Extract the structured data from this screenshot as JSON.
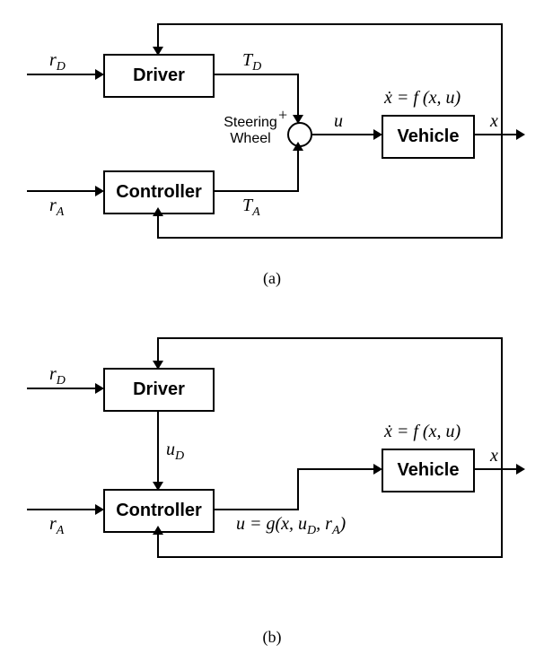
{
  "diagram_a": {
    "blocks": {
      "driver": "Driver",
      "controller": "Controller",
      "vehicle": "Vehicle"
    },
    "labels": {
      "r_D": "r",
      "r_D_sub": "D",
      "r_A": "r",
      "r_A_sub": "A",
      "T_D": "T",
      "T_D_sub": "D",
      "T_A": "T",
      "T_A_sub": "A",
      "u": "u",
      "x": "x",
      "dyn": "ẋ = f (x, u)"
    },
    "annotations": {
      "steering": "Steering\nWheel",
      "plus": "+"
    },
    "caption": "(a)"
  },
  "diagram_b": {
    "blocks": {
      "driver": "Driver",
      "controller": "Controller",
      "vehicle": "Vehicle"
    },
    "labels": {
      "r_D": "r",
      "r_D_sub": "D",
      "r_A": "r",
      "r_A_sub": "A",
      "u_D": "u",
      "u_D_sub": "D",
      "x": "x",
      "dyn": "ẋ = f (x, u)",
      "ueq": "u = g(x, u",
      "ueq_sub": "D",
      "ueq_tail": ", r",
      "ueq_sub2": "A",
      "ueq_end": ")"
    },
    "caption": "(b)"
  }
}
